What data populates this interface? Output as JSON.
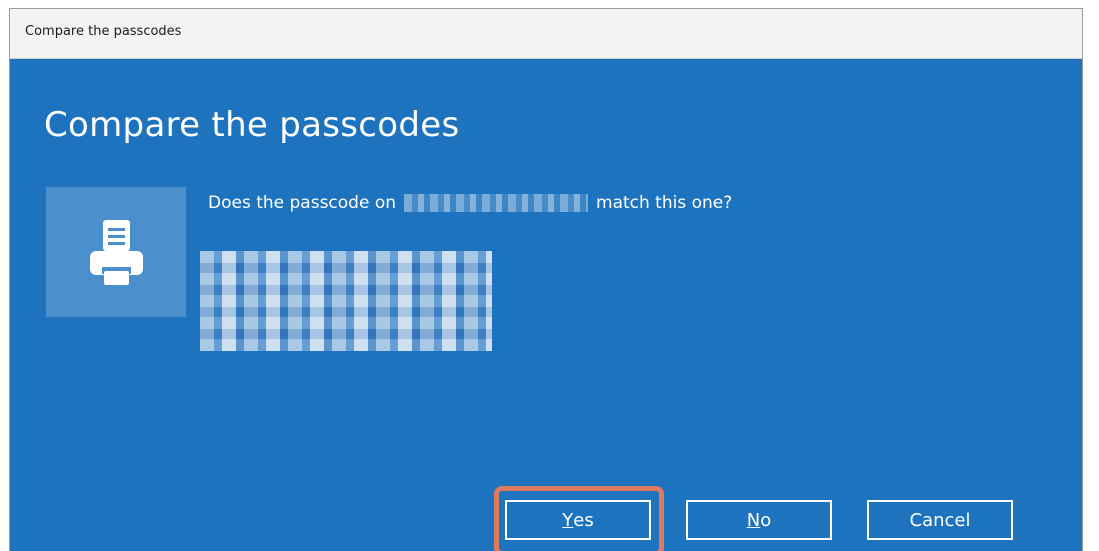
{
  "window": {
    "title": "Compare the passcodes"
  },
  "dialog": {
    "heading": "Compare the passcodes",
    "question_prefix": "Does the passcode on",
    "question_suffix": "match this one?",
    "device_icon": "printer-icon"
  },
  "buttons": {
    "yes_accel": "Y",
    "yes_rest": "es",
    "no_accel": "N",
    "no_rest": "o",
    "cancel": "Cancel"
  },
  "colors": {
    "dialog_background": "#1e73be",
    "icon_tile": "#4b8fcc",
    "highlight": "#e07a5f"
  }
}
